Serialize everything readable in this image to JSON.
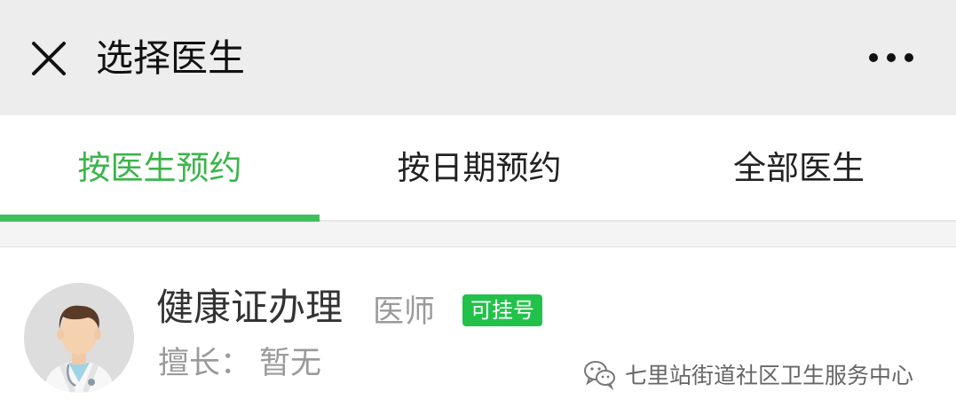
{
  "header": {
    "title": "选择医生",
    "close_icon": "close-icon",
    "more_icon": "more-dots-icon"
  },
  "tabs": [
    {
      "label": "按医生预约",
      "active": true
    },
    {
      "label": "按日期预约",
      "active": false
    },
    {
      "label": "全部医生",
      "active": false
    }
  ],
  "colors": {
    "accent": "#3ec15a",
    "badge": "#22c24a",
    "header_bg": "#ededed"
  },
  "doctor": {
    "name": "健康证办理",
    "title": "医师",
    "badge": "可挂号",
    "specialty_label": "擅长：",
    "specialty_value": "暂无",
    "avatar_icon": "doctor-avatar-icon"
  },
  "watermark": {
    "icon": "wechat-icon",
    "text": "七里站街道社区卫生服务中心"
  }
}
